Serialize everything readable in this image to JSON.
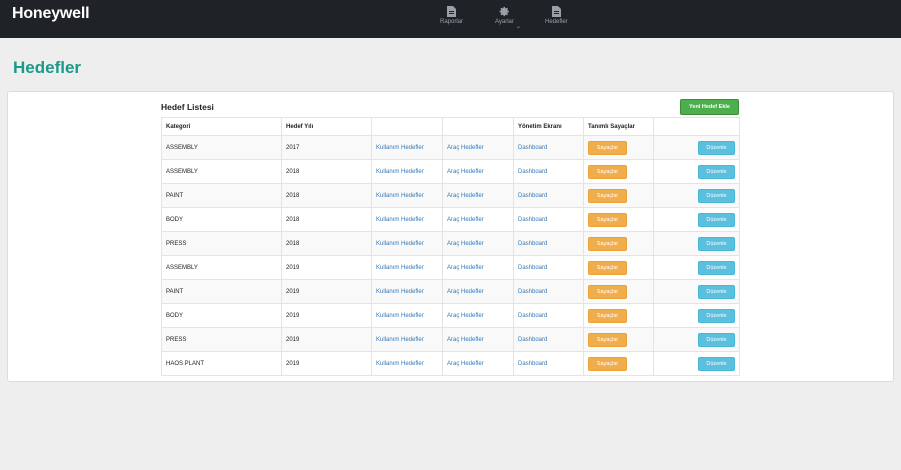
{
  "app": {
    "brand": "Honeywell"
  },
  "nav": [
    {
      "label": "Raporlar",
      "icon": "document-icon"
    },
    {
      "label": "Ayarlar",
      "icon": "gear-icon",
      "has_dropdown": true
    },
    {
      "label": "Hedefler",
      "icon": "document-icon"
    }
  ],
  "page": {
    "title": "Hedefler"
  },
  "list": {
    "title": "Hedef Listesi",
    "new_button": "Yeni Hedef Ekle",
    "columns": [
      "Kategori",
      "Hedef Yılı",
      "",
      "",
      "Yönetim Ekranı",
      "Tanımlı Sayaçlar",
      ""
    ],
    "rows": [
      {
        "category": "ASSEMBLY",
        "year": "2017",
        "usage": "Kullanım Hedefler",
        "vehicle": "Araç Hedefler",
        "dashboard": "Dashboard",
        "counters": "Sayaçlar",
        "edit": "Düzenle"
      },
      {
        "category": "ASSEMBLY",
        "year": "2018",
        "usage": "Kullanım Hedefler",
        "vehicle": "Araç Hedefler",
        "dashboard": "Dashboard",
        "counters": "Sayaçlar",
        "edit": "Düzenle"
      },
      {
        "category": "PAINT",
        "year": "2018",
        "usage": "Kullanım Hedefler",
        "vehicle": "Araç Hedefler",
        "dashboard": "Dashboard",
        "counters": "Sayaçlar",
        "edit": "Düzenle"
      },
      {
        "category": "BODY",
        "year": "2018",
        "usage": "Kullanım Hedefler",
        "vehicle": "Araç Hedefler",
        "dashboard": "Dashboard",
        "counters": "Sayaçlar",
        "edit": "Düzenle"
      },
      {
        "category": "PRESS",
        "year": "2018",
        "usage": "Kullanım Hedefler",
        "vehicle": "Araç Hedefler",
        "dashboard": "Dashboard",
        "counters": "Sayaçlar",
        "edit": "Düzenle"
      },
      {
        "category": "ASSEMBLY",
        "year": "2019",
        "usage": "Kullanım Hedefler",
        "vehicle": "Araç Hedefler",
        "dashboard": "Dashboard",
        "counters": "Sayaçlar",
        "edit": "Düzenle"
      },
      {
        "category": "PAINT",
        "year": "2019",
        "usage": "Kullanım Hedefler",
        "vehicle": "Araç Hedefler",
        "dashboard": "Dashboard",
        "counters": "Sayaçlar",
        "edit": "Düzenle"
      },
      {
        "category": "BODY",
        "year": "2019",
        "usage": "Kullanım Hedefler",
        "vehicle": "Araç Hedefler",
        "dashboard": "Dashboard",
        "counters": "Sayaçlar",
        "edit": "Düzenle"
      },
      {
        "category": "PRESS",
        "year": "2019",
        "usage": "Kullanım Hedefler",
        "vehicle": "Araç Hedefler",
        "dashboard": "Dashboard",
        "counters": "Sayaçlar",
        "edit": "Düzenle"
      },
      {
        "category": "HAOS PLANT",
        "year": "2019",
        "usage": "Kullanım Hedefler",
        "vehicle": "Araç Hedefler",
        "dashboard": "Dashboard",
        "counters": "Sayaçlar",
        "edit": "Düzenle"
      }
    ]
  },
  "colors": {
    "topbar": "#1f2327",
    "title": "#1a9a8a",
    "success": "#4cae4c",
    "warning": "#f0ad4e",
    "info": "#5bc0de",
    "link": "#337ab7"
  }
}
